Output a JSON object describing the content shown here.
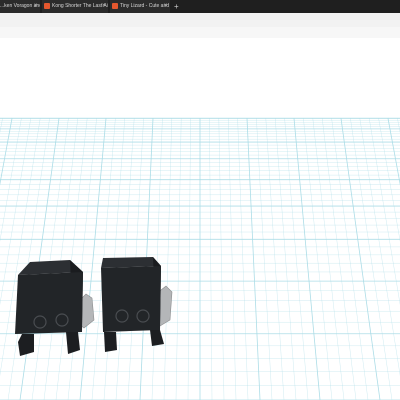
{
  "browser": {
    "tabs": [
      {
        "label": "...ken Voragon and Nico",
        "icon": "tinkercad-favicon-icon",
        "close": "×"
      },
      {
        "label": "Kong Shorter The Last Air Benc",
        "icon": "tinkercad-favicon-icon",
        "close": "×"
      },
      {
        "label": "Tiny Lizard - Cute and NO Sug...",
        "icon": "tinkercad-favicon-icon",
        "close": "×"
      }
    ],
    "new_tab": "+"
  },
  "workplane": {
    "grid_color": "#a9dbe6",
    "background": "#ffffff",
    "objects": [
      {
        "name": "dark-block-figure-left",
        "color": "#222528"
      },
      {
        "name": "dark-block-figure-right",
        "color": "#222528"
      }
    ]
  }
}
